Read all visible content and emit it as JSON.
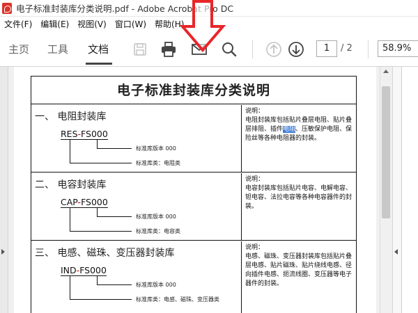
{
  "window": {
    "title": "电子标准封装库分类说明.pdf - Adobe Acrobat Pro DC"
  },
  "menu": [
    "文件(F)",
    "编辑(E)",
    "视图(V)",
    "窗口(W)",
    "帮助(H)"
  ],
  "toolbar": {
    "tabs": [
      "主页",
      "工具",
      "文档"
    ],
    "active_tab": "文档",
    "icons": [
      "save-icon",
      "print-icon",
      "email-icon",
      "search-icon",
      "page-up-icon",
      "page-down-icon"
    ],
    "page_current": "1",
    "page_total": "/ 2",
    "zoom": "58.9%"
  },
  "document": {
    "title": "电子标准封装库分类说明",
    "sections": [
      {
        "heading": "一、 电阻封装库",
        "code_prefix": "RES",
        "code_dash": "-",
        "code_suffix": "FS000",
        "ann_version": "标准库版本 000",
        "ann_type": "标准库类：电阻类",
        "desc_label": "说明：",
        "desc_before": "电阻封装库包括贴片叠层电阻、贴片叠层排阻、插件",
        "desc_highlight": "电阻",
        "desc_after": "、压敏保护电阻、保险丝等各种电阻器的封装。"
      },
      {
        "heading": "二、 电容封装库",
        "code_prefix": "CAP",
        "code_dash": "-",
        "code_suffix": "FS000",
        "ann_version": "标准库版本 000",
        "ann_type": "标准库类：电容类",
        "desc_label": "说明：",
        "desc_text": "电容封装库包括贴片电容、电解电容、钽电容、法拉电容等各种电容器件的封装。"
      },
      {
        "heading": "三、 电感、磁珠、变压器封装库",
        "code_prefix": "IND",
        "code_dash": "-",
        "code_suffix": "FS000",
        "ann_version": "标准库版本 000",
        "ann_type": "标准库类：电感、磁珠、变压器类",
        "desc_label": "说明：",
        "desc_text": "电感、磁珠、变压器封装库包括贴片叠层电感、贴片磁珠、贴片绕线电感、径向插件电感、扼流线圈、变压器等电子器件的封装。"
      }
    ]
  },
  "colors": {
    "highlight": "#3b7dd8",
    "arrow": "#e8262a",
    "brand": "#d9342b"
  }
}
